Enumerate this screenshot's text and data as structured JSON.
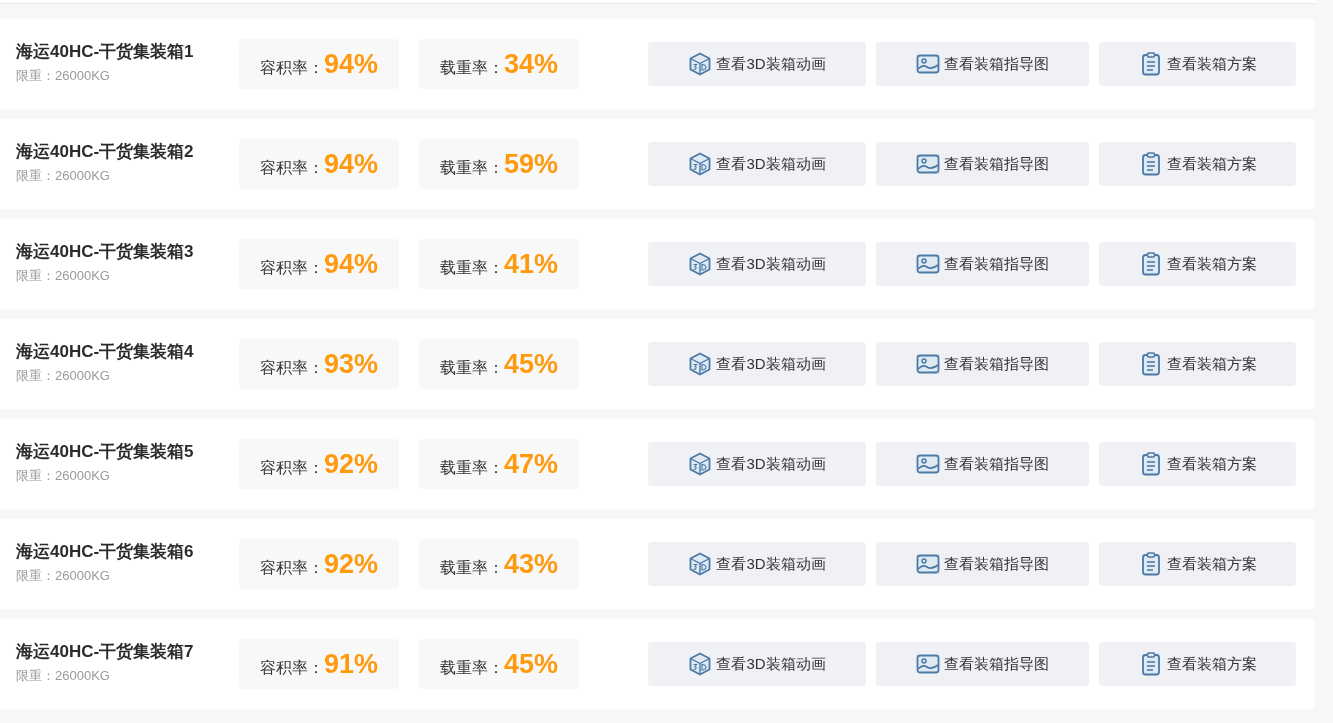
{
  "containers": [
    {
      "name": "海运40HC-干货集装箱1",
      "weight_limit": "限重：26000KG",
      "volume_rate": {
        "label": "容积率：",
        "value": "94%"
      },
      "load_rate": {
        "label": "载重率：",
        "value": "34%"
      },
      "actions": [
        {
          "kind": "animation",
          "label": "查看3D装箱动画"
        },
        {
          "kind": "guide",
          "label": "查看装箱指导图"
        },
        {
          "kind": "plan",
          "label": "查看装箱方案"
        }
      ]
    },
    {
      "name": "海运40HC-干货集装箱2",
      "weight_limit": "限重：26000KG",
      "volume_rate": {
        "label": "容积率：",
        "value": "94%"
      },
      "load_rate": {
        "label": "载重率：",
        "value": "59%"
      },
      "actions": [
        {
          "kind": "animation",
          "label": "查看3D装箱动画"
        },
        {
          "kind": "guide",
          "label": "查看装箱指导图"
        },
        {
          "kind": "plan",
          "label": "查看装箱方案"
        }
      ]
    },
    {
      "name": "海运40HC-干货集装箱3",
      "weight_limit": "限重：26000KG",
      "volume_rate": {
        "label": "容积率：",
        "value": "94%"
      },
      "load_rate": {
        "label": "载重率：",
        "value": "41%"
      },
      "actions": [
        {
          "kind": "animation",
          "label": "查看3D装箱动画"
        },
        {
          "kind": "guide",
          "label": "查看装箱指导图"
        },
        {
          "kind": "plan",
          "label": "查看装箱方案"
        }
      ]
    },
    {
      "name": "海运40HC-干货集装箱4",
      "weight_limit": "限重：26000KG",
      "volume_rate": {
        "label": "容积率：",
        "value": "93%"
      },
      "load_rate": {
        "label": "载重率：",
        "value": "45%"
      },
      "actions": [
        {
          "kind": "animation",
          "label": "查看3D装箱动画"
        },
        {
          "kind": "guide",
          "label": "查看装箱指导图"
        },
        {
          "kind": "plan",
          "label": "查看装箱方案"
        }
      ]
    },
    {
      "name": "海运40HC-干货集装箱5",
      "weight_limit": "限重：26000KG",
      "volume_rate": {
        "label": "容积率：",
        "value": "92%"
      },
      "load_rate": {
        "label": "载重率：",
        "value": "47%"
      },
      "actions": [
        {
          "kind": "animation",
          "label": "查看3D装箱动画"
        },
        {
          "kind": "guide",
          "label": "查看装箱指导图"
        },
        {
          "kind": "plan",
          "label": "查看装箱方案"
        }
      ]
    },
    {
      "name": "海运40HC-干货集装箱6",
      "weight_limit": "限重：26000KG",
      "volume_rate": {
        "label": "容积率：",
        "value": "92%"
      },
      "load_rate": {
        "label": "载重率：",
        "value": "43%"
      },
      "actions": [
        {
          "kind": "animation",
          "label": "查看3D装箱动画"
        },
        {
          "kind": "guide",
          "label": "查看装箱指导图"
        },
        {
          "kind": "plan",
          "label": "查看装箱方案"
        }
      ]
    },
    {
      "name": "海运40HC-干货集装箱7",
      "weight_limit": "限重：26000KG",
      "volume_rate": {
        "label": "容积率：",
        "value": "91%"
      },
      "load_rate": {
        "label": "载重率：",
        "value": "45%"
      },
      "actions": [
        {
          "kind": "animation",
          "label": "查看3D装箱动画"
        },
        {
          "kind": "guide",
          "label": "查看装箱指导图"
        },
        {
          "kind": "plan",
          "label": "查看装箱方案"
        }
      ]
    }
  ]
}
